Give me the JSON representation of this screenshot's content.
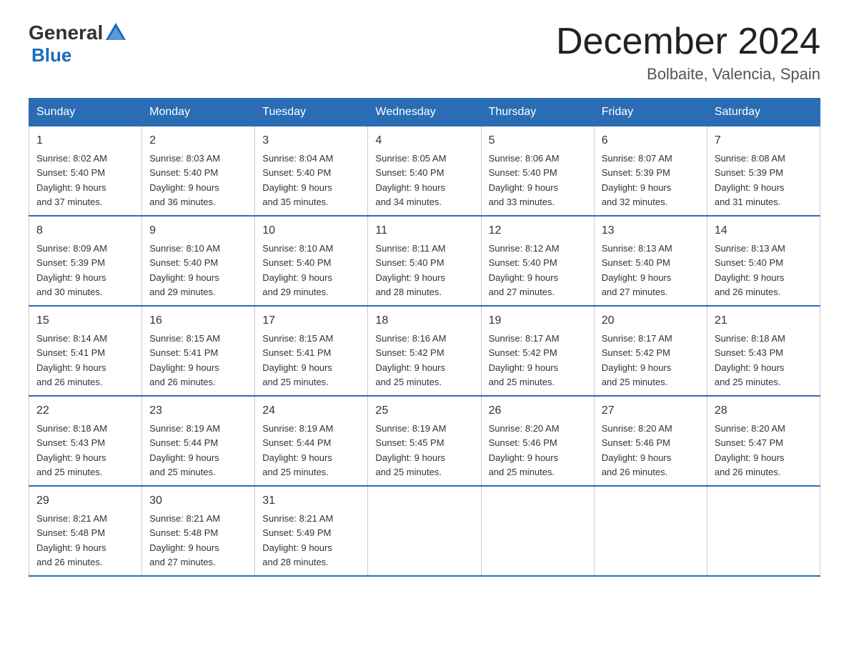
{
  "header": {
    "logo_general": "General",
    "logo_blue": "Blue",
    "month_title": "December 2024",
    "location": "Bolbaite, Valencia, Spain"
  },
  "days_of_week": [
    "Sunday",
    "Monday",
    "Tuesday",
    "Wednesday",
    "Thursday",
    "Friday",
    "Saturday"
  ],
  "weeks": [
    [
      {
        "num": "1",
        "sunrise": "8:02 AM",
        "sunset": "5:40 PM",
        "daylight": "9 hours and 37 minutes."
      },
      {
        "num": "2",
        "sunrise": "8:03 AM",
        "sunset": "5:40 PM",
        "daylight": "9 hours and 36 minutes."
      },
      {
        "num": "3",
        "sunrise": "8:04 AM",
        "sunset": "5:40 PM",
        "daylight": "9 hours and 35 minutes."
      },
      {
        "num": "4",
        "sunrise": "8:05 AM",
        "sunset": "5:40 PM",
        "daylight": "9 hours and 34 minutes."
      },
      {
        "num": "5",
        "sunrise": "8:06 AM",
        "sunset": "5:40 PM",
        "daylight": "9 hours and 33 minutes."
      },
      {
        "num": "6",
        "sunrise": "8:07 AM",
        "sunset": "5:39 PM",
        "daylight": "9 hours and 32 minutes."
      },
      {
        "num": "7",
        "sunrise": "8:08 AM",
        "sunset": "5:39 PM",
        "daylight": "9 hours and 31 minutes."
      }
    ],
    [
      {
        "num": "8",
        "sunrise": "8:09 AM",
        "sunset": "5:39 PM",
        "daylight": "9 hours and 30 minutes."
      },
      {
        "num": "9",
        "sunrise": "8:10 AM",
        "sunset": "5:40 PM",
        "daylight": "9 hours and 29 minutes."
      },
      {
        "num": "10",
        "sunrise": "8:10 AM",
        "sunset": "5:40 PM",
        "daylight": "9 hours and 29 minutes."
      },
      {
        "num": "11",
        "sunrise": "8:11 AM",
        "sunset": "5:40 PM",
        "daylight": "9 hours and 28 minutes."
      },
      {
        "num": "12",
        "sunrise": "8:12 AM",
        "sunset": "5:40 PM",
        "daylight": "9 hours and 27 minutes."
      },
      {
        "num": "13",
        "sunrise": "8:13 AM",
        "sunset": "5:40 PM",
        "daylight": "9 hours and 27 minutes."
      },
      {
        "num": "14",
        "sunrise": "8:13 AM",
        "sunset": "5:40 PM",
        "daylight": "9 hours and 26 minutes."
      }
    ],
    [
      {
        "num": "15",
        "sunrise": "8:14 AM",
        "sunset": "5:41 PM",
        "daylight": "9 hours and 26 minutes."
      },
      {
        "num": "16",
        "sunrise": "8:15 AM",
        "sunset": "5:41 PM",
        "daylight": "9 hours and 26 minutes."
      },
      {
        "num": "17",
        "sunrise": "8:15 AM",
        "sunset": "5:41 PM",
        "daylight": "9 hours and 25 minutes."
      },
      {
        "num": "18",
        "sunrise": "8:16 AM",
        "sunset": "5:42 PM",
        "daylight": "9 hours and 25 minutes."
      },
      {
        "num": "19",
        "sunrise": "8:17 AM",
        "sunset": "5:42 PM",
        "daylight": "9 hours and 25 minutes."
      },
      {
        "num": "20",
        "sunrise": "8:17 AM",
        "sunset": "5:42 PM",
        "daylight": "9 hours and 25 minutes."
      },
      {
        "num": "21",
        "sunrise": "8:18 AM",
        "sunset": "5:43 PM",
        "daylight": "9 hours and 25 minutes."
      }
    ],
    [
      {
        "num": "22",
        "sunrise": "8:18 AM",
        "sunset": "5:43 PM",
        "daylight": "9 hours and 25 minutes."
      },
      {
        "num": "23",
        "sunrise": "8:19 AM",
        "sunset": "5:44 PM",
        "daylight": "9 hours and 25 minutes."
      },
      {
        "num": "24",
        "sunrise": "8:19 AM",
        "sunset": "5:44 PM",
        "daylight": "9 hours and 25 minutes."
      },
      {
        "num": "25",
        "sunrise": "8:19 AM",
        "sunset": "5:45 PM",
        "daylight": "9 hours and 25 minutes."
      },
      {
        "num": "26",
        "sunrise": "8:20 AM",
        "sunset": "5:46 PM",
        "daylight": "9 hours and 25 minutes."
      },
      {
        "num": "27",
        "sunrise": "8:20 AM",
        "sunset": "5:46 PM",
        "daylight": "9 hours and 26 minutes."
      },
      {
        "num": "28",
        "sunrise": "8:20 AM",
        "sunset": "5:47 PM",
        "daylight": "9 hours and 26 minutes."
      }
    ],
    [
      {
        "num": "29",
        "sunrise": "8:21 AM",
        "sunset": "5:48 PM",
        "daylight": "9 hours and 26 minutes."
      },
      {
        "num": "30",
        "sunrise": "8:21 AM",
        "sunset": "5:48 PM",
        "daylight": "9 hours and 27 minutes."
      },
      {
        "num": "31",
        "sunrise": "8:21 AM",
        "sunset": "5:49 PM",
        "daylight": "9 hours and 28 minutes."
      },
      null,
      null,
      null,
      null
    ]
  ],
  "labels": {
    "sunrise": "Sunrise:",
    "sunset": "Sunset:",
    "daylight": "Daylight:"
  }
}
